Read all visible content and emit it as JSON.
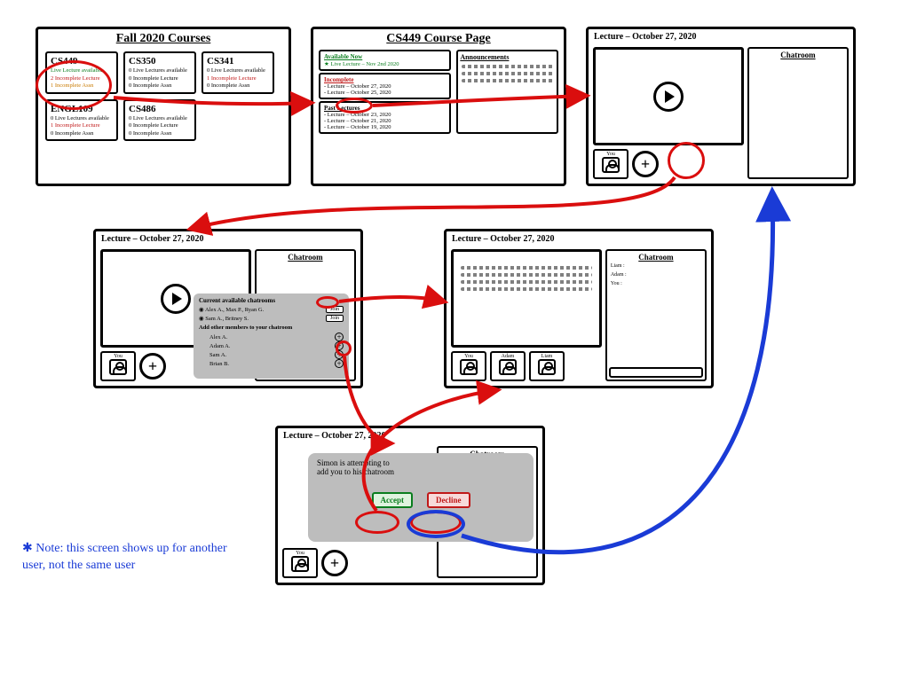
{
  "note": "✱ Note: this screen shows up for another user, not the same user",
  "panel1": {
    "title": "Fall 2020 Courses",
    "courses": [
      {
        "code": "CS449",
        "l1": "Live Lecture available",
        "l2": "2 Incomplete Lecture",
        "l3": "1 Incomplete Assn"
      },
      {
        "code": "CS350",
        "l1": "0 Live Lectures available",
        "l2": "0 Incomplete Lecture",
        "l3": "0 Incomplete Assn"
      },
      {
        "code": "CS341",
        "l1": "0 Live Lectures available",
        "l2": "1 Incomplete Lecture",
        "l3": "0 Incomplete Assn"
      },
      {
        "code": "ENGL109",
        "l1": "0 Live Lectures available",
        "l2": "1 Incomplete Lecture",
        "l3": "0 Incomplete Assn"
      },
      {
        "code": "CS486",
        "l1": "0 Live Lectures available",
        "l2": "0 Incomplete Lecture",
        "l3": "0 Incomplete Assn"
      }
    ]
  },
  "panel2": {
    "title": "CS449 Course Page",
    "available": {
      "label": "Available Now",
      "item": "★ Live Lecture – Nov 2nd 2020"
    },
    "incomplete": {
      "label": "Incomplete",
      "items": [
        "- Lecture – October 27, 2020",
        "- Lecture – October 25, 2020"
      ]
    },
    "past": {
      "label": "Past Lectures",
      "items": [
        "- Lecture – October 23, 2020",
        "- Lecture – October 21, 2020",
        "- Lecture – October 19, 2020"
      ]
    },
    "announcements": "Announcements"
  },
  "lecture_header": "Lecture – October 27, 2020",
  "chat_label": "Chatroom",
  "you_label": "You",
  "add_label": "+",
  "panel4": {
    "popup_title": "Current available chatrooms",
    "rooms": [
      {
        "members": "Alex A., Max P., Ryan G.",
        "btn": "Join"
      },
      {
        "members": "Sam A., Britney S.",
        "btn": "Join"
      }
    ],
    "add_section": "Add other members to your chatroom",
    "people": [
      "Alex A.",
      "Adam A.",
      "Sam A.",
      "Brian B."
    ]
  },
  "panel5": {
    "participants": [
      "You",
      "Adam",
      "Liam"
    ],
    "chat_names": [
      "Liam :",
      "Adam :",
      "You :"
    ]
  },
  "panel6": {
    "msg_l1": "Simon is attempting to",
    "msg_l2": "add you to his chatroom",
    "accept": "Accept",
    "decline": "Decline"
  }
}
